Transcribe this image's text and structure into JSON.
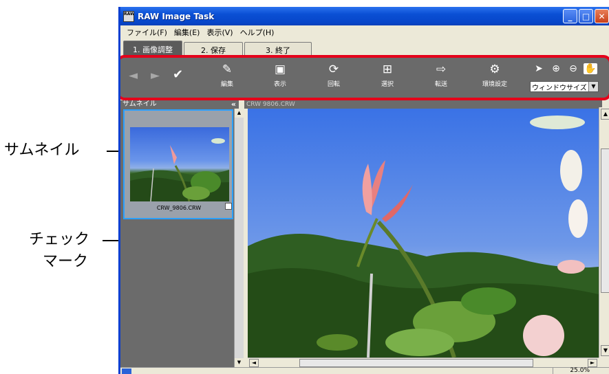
{
  "window": {
    "title": "RAW Image Task",
    "app_icon_text": "RAW"
  },
  "menubar": [
    "ファイル(F)",
    "編集(E)",
    "表示(V)",
    "ヘルプ(H)"
  ],
  "tabs": [
    {
      "label": "1. 画像調整",
      "active": true
    },
    {
      "label": "2. 保存",
      "active": false
    },
    {
      "label": "3. 終了",
      "active": false
    }
  ],
  "toolbar": {
    "tools": [
      {
        "label": "編集",
        "icon": "edit-icon"
      },
      {
        "label": "表示",
        "icon": "display-icon"
      },
      {
        "label": "回転",
        "icon": "rotate-icon"
      },
      {
        "label": "選択",
        "icon": "select-grid-icon"
      },
      {
        "label": "転送",
        "icon": "transfer-icon"
      },
      {
        "label": "環境設定",
        "icon": "settings-icon"
      }
    ],
    "window_size": "ウィンドウサイズ"
  },
  "thumbnail_panel": {
    "header": "サムネイル",
    "collapse": "«",
    "filename": "CRW_9806.CRW"
  },
  "preview": {
    "header": "CRW 9806.CRW"
  },
  "status": {
    "zoom": "25.0%"
  },
  "callouts": {
    "thumbnail": "サムネイル",
    "checkmark_line1": "チェック",
    "checkmark_line2": "マーク"
  },
  "colors": {
    "toolbar_bg": "#6a6a6a",
    "highlight_frame": "#e5001a",
    "title_blue": "#0a4fd4",
    "selection_border": "#2aa0ff"
  }
}
